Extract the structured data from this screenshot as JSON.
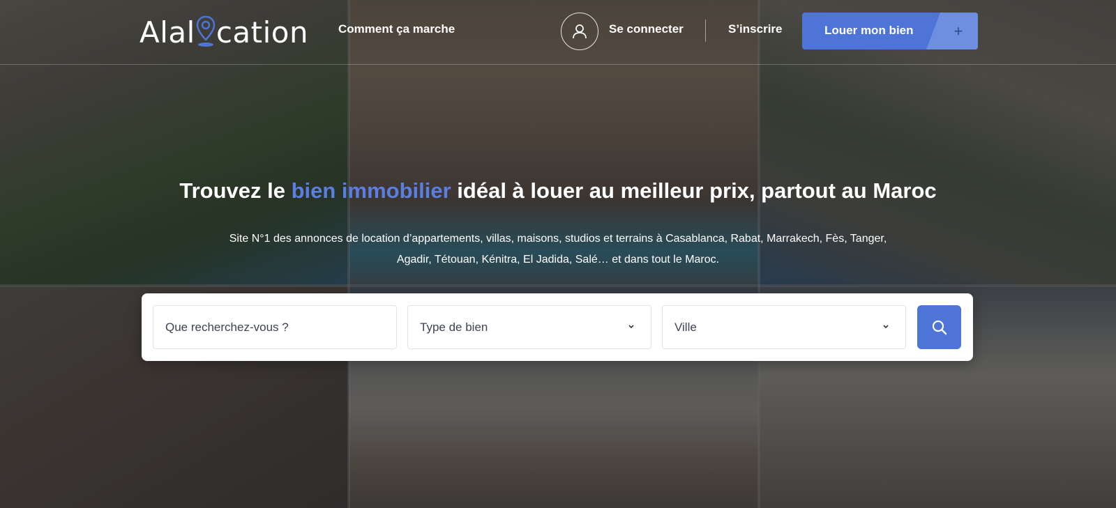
{
  "header": {
    "logo_text_before": "Alal",
    "logo_text_after": "cation",
    "nav_how_it_works": "Comment ça marche",
    "login_label": "Se connecter",
    "signup_label": "S’inscrire",
    "rent_button_label": "Louer mon bien",
    "rent_button_icon": "+"
  },
  "hero": {
    "headline_before": "Trouvez le ",
    "headline_accent": "bien immobilier",
    "headline_after": " idéal à louer au meilleur prix, partout au Maroc",
    "subline_1": "Site N°1 des annonces de location d’appartements, villas, maisons, studios et terrains à Casablanca, Rabat, Marrakech, Fès, Tanger,",
    "subline_2": "Agadir, Tétouan, Kénitra, El Jadida, Salé… et dans tout le Maroc."
  },
  "search": {
    "query_placeholder": "Que recherchez-vous ?",
    "property_type_label": "Type de bien",
    "city_label": "Ville"
  },
  "icons": {
    "logo": "map-pin-icon",
    "user": "user-icon",
    "plus": "plus-icon",
    "chevron": "chevron-down-icon",
    "search": "search-icon"
  },
  "colors": {
    "accent": "#4d74d6",
    "headline_accent": "#5a7fe0",
    "text_light": "#ffffff"
  }
}
